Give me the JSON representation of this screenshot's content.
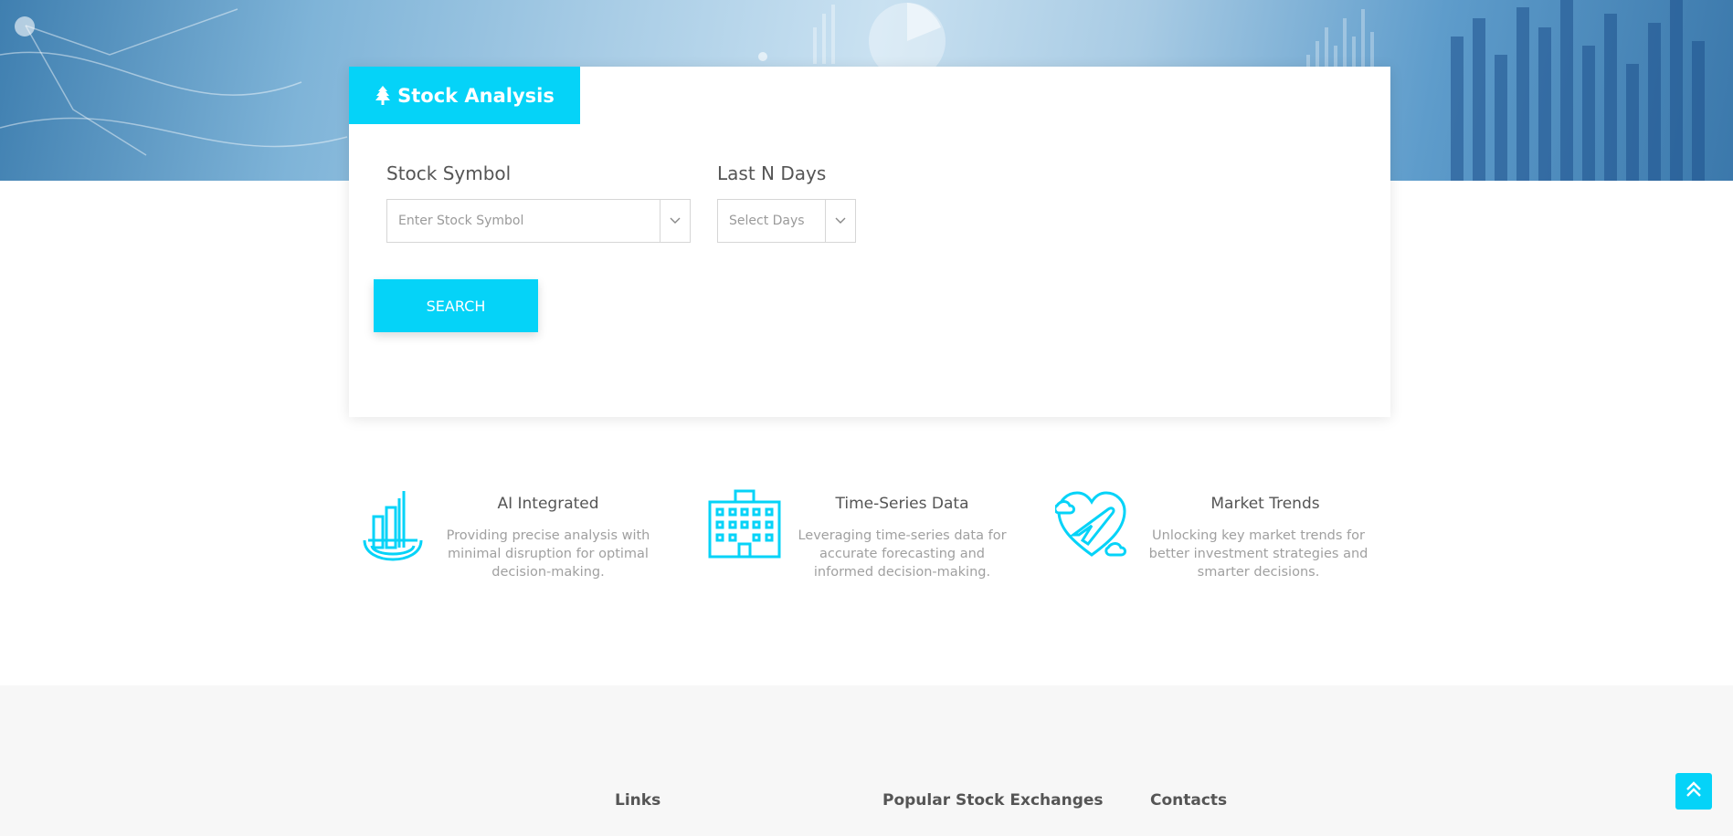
{
  "card": {
    "tab_title": "Stock Analysis",
    "stock_symbol": {
      "label": "Stock Symbol",
      "placeholder": "Enter Stock Symbol"
    },
    "last_n_days": {
      "label": "Last N Days",
      "placeholder": "Select Days"
    },
    "search_label": "SEARCH"
  },
  "features": [
    {
      "title": "AI Integrated",
      "text": "Providing precise analysis with minimal disruption for optimal decision-making.",
      "icon": "chart-bowl-icon"
    },
    {
      "title": "Time-Series Data",
      "text": "Leveraging time-series data for accurate forecasting and informed decision-making.",
      "icon": "building-icon"
    },
    {
      "title": "Market Trends",
      "text": "Unlocking key market trends for better investment strategies and smarter decisions.",
      "icon": "heart-plane-icon"
    }
  ],
  "footer": {
    "headings": [
      "Links",
      "Popular Stock Exchanges",
      "Contacts"
    ]
  },
  "colors": {
    "accent": "#05d3f8",
    "footer_bg": "#f7f7f7"
  },
  "icons": {
    "tab": "tree-icon",
    "caret": "chevron-down-icon",
    "back_to_top": "double-chevron-up-icon"
  }
}
